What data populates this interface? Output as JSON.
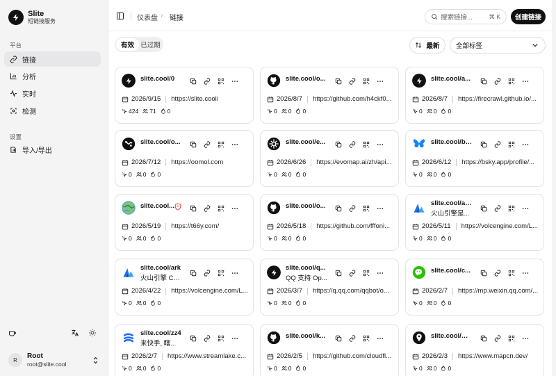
{
  "app": {
    "name": "Slite",
    "subtitle": "短链接服务"
  },
  "sidebar": {
    "section_platform": "平台",
    "items": [
      {
        "label": "链接",
        "icon": "link-icon"
      },
      {
        "label": "分析",
        "icon": "bar-chart-icon"
      },
      {
        "label": "实时",
        "icon": "activity-icon"
      },
      {
        "label": "检测",
        "icon": "scan-icon"
      }
    ],
    "section_settings": "设置",
    "settings_items": [
      {
        "label": "导入/导出",
        "icon": "import-export-icon"
      }
    ]
  },
  "user": {
    "initial": "R",
    "name": "Root",
    "email": "root@slite.cool"
  },
  "header": {
    "breadcrumb": [
      "仪表盘",
      "链接"
    ],
    "search_placeholder": "搜索链接...",
    "search_shortcut": "⌘ K",
    "create_label": "创建链接"
  },
  "filters": {
    "tabs": [
      "有效",
      "已过期"
    ],
    "active_tab": 0,
    "sort_label": "最新",
    "tag_label": "全部标签"
  },
  "colors": {
    "accent": "#111111",
    "shield": "#e0443a"
  },
  "links": [
    {
      "short": "slite.cool/0",
      "desc": "",
      "date": "2026/9/15",
      "url": "https://slite.cool/",
      "clicks": "424",
      "visitors": "71",
      "hot": "0",
      "icon": "bolt-icon"
    },
    {
      "short": "slite.cool/o...",
      "desc": "",
      "date": "2026/8/7",
      "url": "https://github.com/h4ckf0...",
      "clicks": "0",
      "visitors": "0",
      "hot": "0",
      "icon": "github-icon"
    },
    {
      "short": "slite.cool/a...",
      "desc": "",
      "date": "2026/8/7",
      "url": "https://firecrawl.github.io/...",
      "clicks": "0",
      "visitors": "0",
      "hot": "0",
      "icon": "bolt-icon"
    },
    {
      "short": "slite.cool/o...",
      "desc": "",
      "date": "2026/7/12",
      "url": "https://oomol.com",
      "clicks": "0",
      "visitors": "0",
      "hot": "0",
      "icon": "oomol-icon"
    },
    {
      "short": "slite.cool/e...",
      "desc": "",
      "date": "2026/6/26",
      "url": "https://evomap.ai/zh/api...",
      "clicks": "0",
      "visitors": "0",
      "hot": "0",
      "icon": "evomap-icon"
    },
    {
      "short": "slite.cool/bl...",
      "desc": "",
      "date": "2026/6/12",
      "url": "https://bsky.app/profile/...",
      "clicks": "0",
      "visitors": "0",
      "hot": "0",
      "icon": "butterfly-icon"
    },
    {
      "short": "slite.cool...",
      "desc": "",
      "date": "2026/5/19",
      "url": "https://t66y.com/",
      "clicks": "0",
      "visitors": "0",
      "hot": "0",
      "icon": "globe-icon",
      "shield": true
    },
    {
      "short": "slite.cool/o...",
      "desc": "",
      "date": "2026/5/18",
      "url": "https://github.com/fffoni...",
      "clicks": "0",
      "visitors": "0",
      "hot": "0",
      "icon": "github-icon"
    },
    {
      "short": "slite.cool/ar...",
      "desc": "火山引擎是...",
      "date": "2026/5/11",
      "url": "https://volcengine.com/L...",
      "clicks": "0",
      "visitors": "0",
      "hot": "0",
      "icon": "volcengine-icon"
    },
    {
      "short": "slite.cool/ark",
      "desc": "火山引擎 Co...",
      "date": "2026/4/22",
      "url": "https://volcengine.com/L...",
      "clicks": "0",
      "visitors": "0",
      "hot": "0",
      "icon": "volcengine-icon"
    },
    {
      "short": "slite.cool/q...",
      "desc": "QQ 支持 Op...",
      "date": "2026/3/7",
      "url": "https://q.qq.com/qqbot/o...",
      "clicks": "0",
      "visitors": "0",
      "hot": "0",
      "icon": "bolt-icon"
    },
    {
      "short": "slite.cool/c...",
      "desc": "",
      "date": "2026/2/7",
      "url": "https://mp.weixin.qq.com/...",
      "clicks": "0",
      "visitors": "0",
      "hot": "0",
      "icon": "wechat-icon"
    },
    {
      "short": "slite.cool/zz4",
      "desc": "来快手, 瞎...",
      "date": "2026/2/7",
      "url": "https://www.streamlake.c...",
      "clicks": "0",
      "visitors": "0",
      "hot": "0",
      "icon": "streamlake-icon"
    },
    {
      "short": "slite.cool/k...",
      "desc": "",
      "date": "2026/2/5",
      "url": "https://github.com/cloudfl...",
      "clicks": "0",
      "visitors": "0",
      "hot": "0",
      "icon": "github-icon"
    },
    {
      "short": "slite.cool/m...",
      "desc": "",
      "date": "2026/2/3",
      "url": "https://www.mapcn.dev/",
      "clicks": "0",
      "visitors": "0",
      "hot": "0",
      "icon": "map-pin-icon"
    }
  ]
}
